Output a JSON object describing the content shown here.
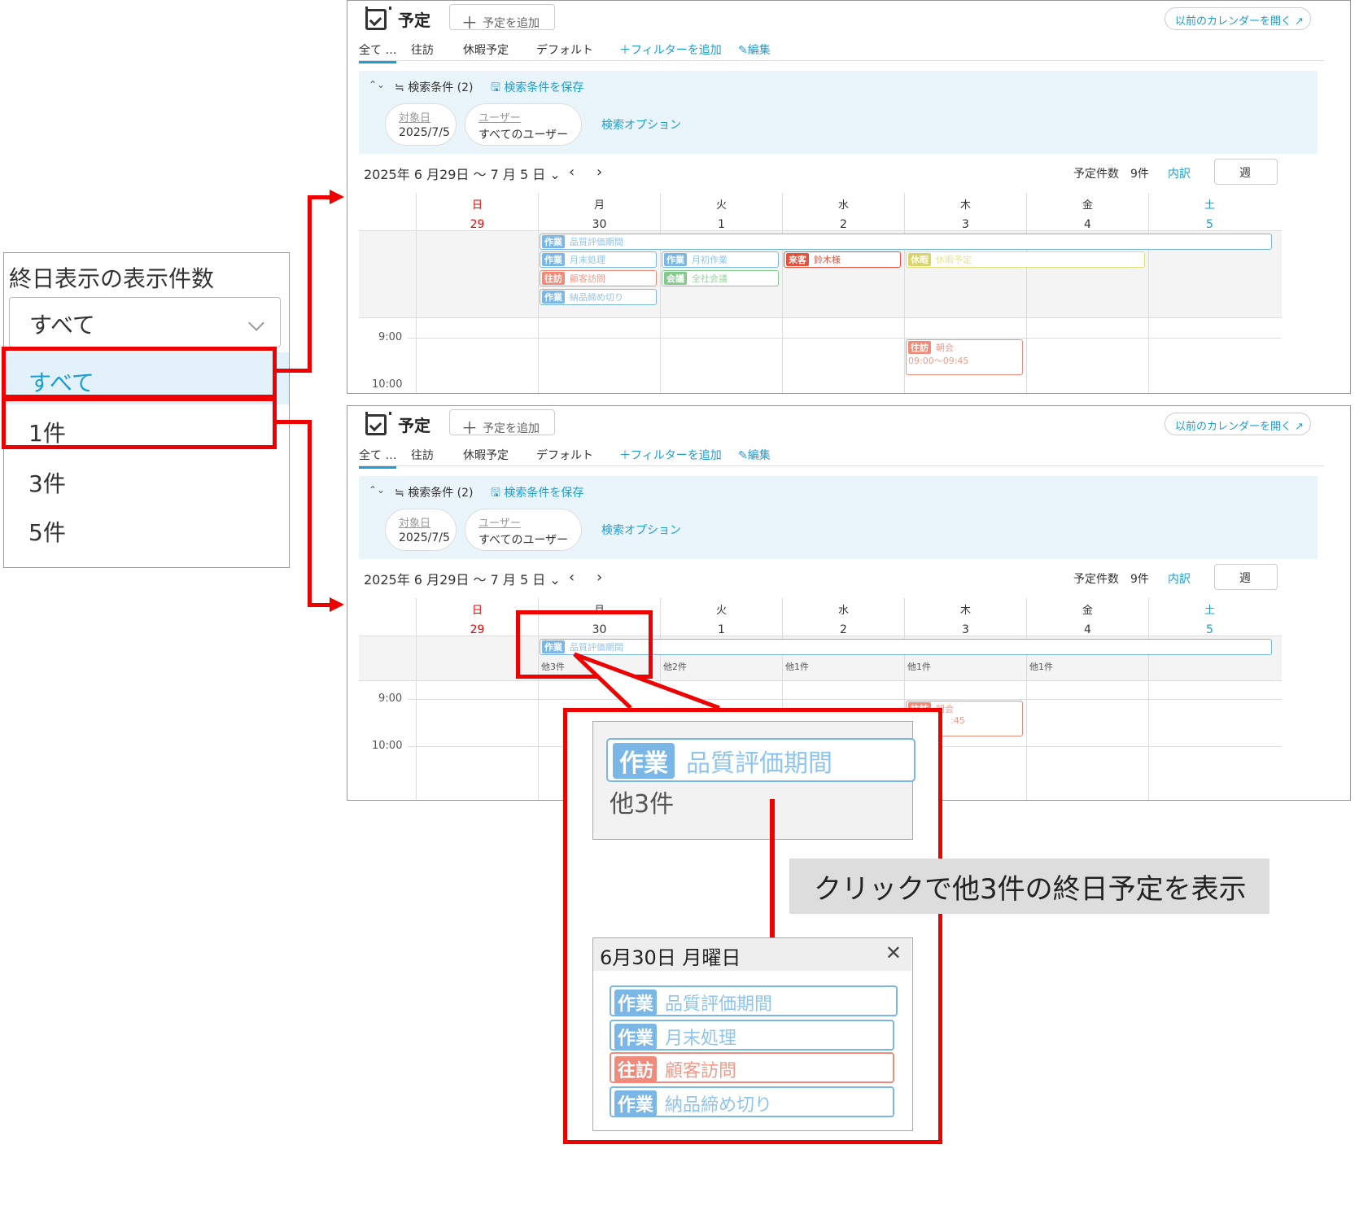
{
  "dropdown": {
    "title": "終日表示の表示件数",
    "selected": "すべて",
    "options": [
      "すべて",
      "1件",
      "3件",
      "5件"
    ]
  },
  "calendar": {
    "title": "予定",
    "add_label": "予定を追加",
    "old_calendar": "以前のカレンダーを開く ↗",
    "tabs": [
      "全て …",
      "往訪",
      "休暇予定",
      "デフォルト"
    ],
    "add_filter": "＋フィルターを追加",
    "edit": "✎編集",
    "search_toggle": "⌃⌄",
    "search_cond": "≒ 検索条件 (2)",
    "save_cond": "🖫 検索条件を保存",
    "chip_date_label": "対象日",
    "chip_date_value": "2025/7/5",
    "chip_user_label": "ユーザー",
    "chip_user_value": "すべてのユーザー",
    "search_options": "検索オプション",
    "range": "2025年 6 月29日 〜 7 月 5 日",
    "range_chev": "⌄",
    "prev": "‹",
    "next": "›",
    "count": "予定件数　9件",
    "breakdown": "内訳",
    "view": "週",
    "days": [
      {
        "dn": "日",
        "d": "29",
        "color": "#e00"
      },
      {
        "dn": "月",
        "d": "30",
        "color": "#333"
      },
      {
        "dn": "火",
        "d": "1",
        "color": "#333"
      },
      {
        "dn": "水",
        "d": "2",
        "color": "#333"
      },
      {
        "dn": "木",
        "d": "3",
        "color": "#333"
      },
      {
        "dn": "金",
        "d": "4",
        "color": "#333"
      },
      {
        "dn": "土",
        "d": "5",
        "color": "#1a9ed4"
      }
    ],
    "time_9": "9:00",
    "time_10": "10:00",
    "events": {
      "e1": {
        "tag": "作業",
        "text": "品質評価期間"
      },
      "e2": {
        "tag": "作業",
        "text": "月末処理"
      },
      "e3": {
        "tag": "往訪",
        "text": "顧客訪問"
      },
      "e4": {
        "tag": "作業",
        "text": "納品締め切り"
      },
      "e5": {
        "tag": "作業",
        "text": "月初作業"
      },
      "e6": {
        "tag": "会議",
        "text": "全社会議"
      },
      "e7": {
        "tag": "来客",
        "text": "鈴木様"
      },
      "e8": {
        "tag": "休暇",
        "text": "休暇予定"
      },
      "e9": {
        "tag": "往訪",
        "text": "朝会",
        "time": "09:00〜09:45"
      }
    },
    "more": [
      "他3件",
      "他2件",
      "他1件",
      "他1件",
      "他1件"
    ],
    "e9_time_partial": ":45"
  },
  "zoom": {
    "event_tag": "作業",
    "event_text": "品質評価期間",
    "more": "他3件"
  },
  "note": "クリックで他3件の終日予定を表示",
  "popup": {
    "title": "6月30日 月曜日",
    "close": "✕",
    "events": [
      {
        "tag": "作業",
        "text": "品質評価期間"
      },
      {
        "tag": "作業",
        "text": "月末処理"
      },
      {
        "tag": "往訪",
        "text": "顧客訪問"
      },
      {
        "tag": "作業",
        "text": "納品締め切り"
      }
    ]
  },
  "colors": {
    "accent": "#1a9ed4",
    "highlight": "#e00000",
    "work": "#7ab7e6",
    "visit": "#f08a7a",
    "meeting": "#84c98c",
    "leave": "#d8d36a",
    "guest": "#e84e3a"
  }
}
